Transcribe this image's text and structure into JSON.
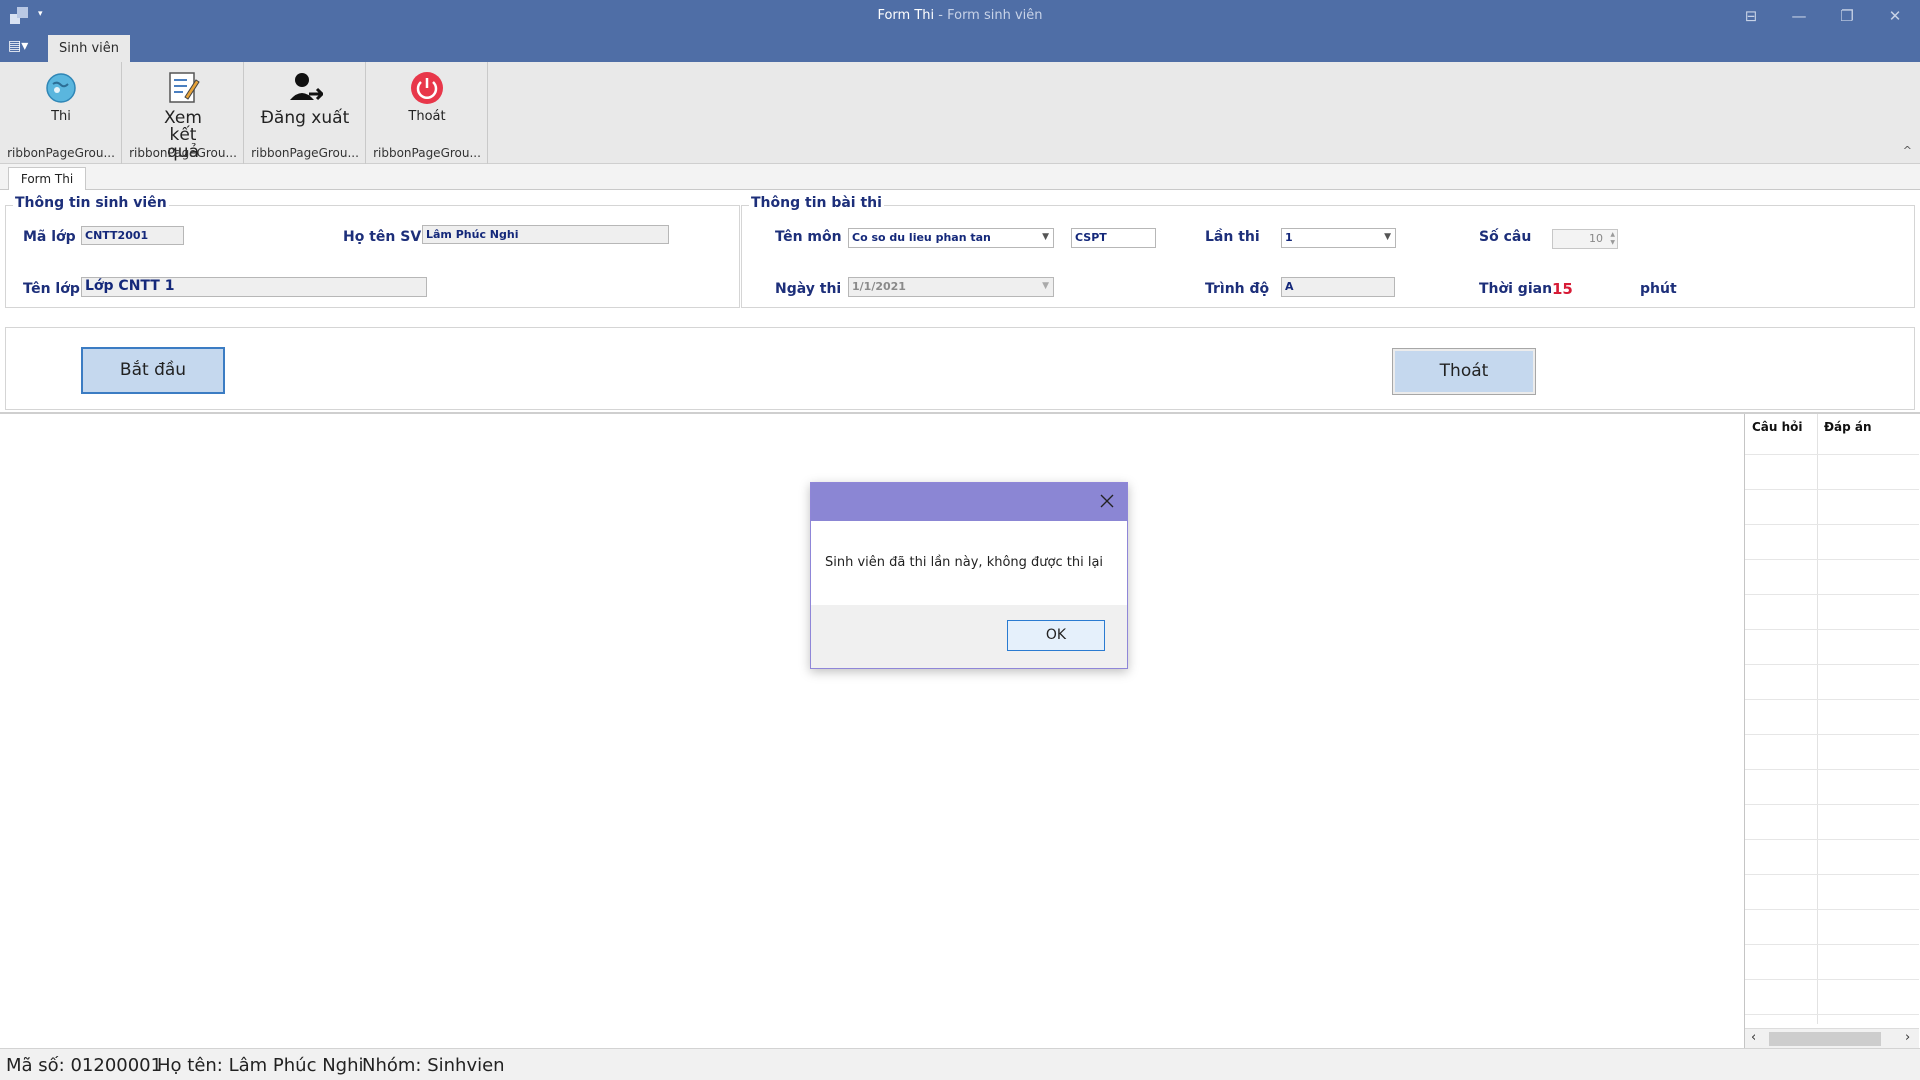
{
  "window": {
    "title_main": "Form Thi",
    "title_sub": " - Form sinh viên",
    "qat_arrow": "▾",
    "buttons": {
      "pin": "⊟",
      "minimize": "—",
      "restore": "❐",
      "close": "✕"
    }
  },
  "ribbon": {
    "app_menu": "▤▾",
    "tab": "Sinh viên",
    "groups": [
      {
        "label": "Thi",
        "icon": "globe-exam-icon",
        "caption": "ribbonPageGrou..."
      },
      {
        "label": "Xem kết quả",
        "icon": "edit-result-icon",
        "caption": "ribbonPageGrou..."
      },
      {
        "label": "Đăng xuất",
        "icon": "logout-user-icon",
        "caption": "ribbonPageGrou..."
      },
      {
        "label": "Thoát",
        "icon": "power-icon",
        "caption": "ribbonPageGrou..."
      }
    ],
    "collapse": "^"
  },
  "doc_tab": "Form Thi",
  "student_info": {
    "title": "Thông tin sinh viên",
    "ma_lop_label": "Mã lớp",
    "ma_lop": "CNTT2001",
    "ho_ten_label": "Họ tên SV",
    "ho_ten": "Lâm Phúc Nghi",
    "ten_lop_label": "Tên lớp",
    "ten_lop": "Lớp CNTT 1"
  },
  "exam_info": {
    "title": "Thông tin bài thi",
    "ten_mon_label": "Tên môn",
    "ten_mon": "Co so du lieu phan tan",
    "ma_mon": "CSPT",
    "lan_thi_label": "Lần thi",
    "lan_thi": "1",
    "so_cau_label": "Số câu",
    "so_cau": "10",
    "ngay_thi_label": "Ngày thi",
    "ngay_thi": "1/1/2021",
    "trinh_do_label": "Trình độ",
    "trinh_do": "A",
    "thoi_gian_label": "Thời gian",
    "thoi_gian": "15",
    "phut": "phút"
  },
  "actions": {
    "start": "Bắt đầu",
    "quit": "Thoát"
  },
  "grid": {
    "col1": "Câu hỏi",
    "col2": "Đáp án"
  },
  "status": {
    "ma_so": "Mã số: 01200001",
    "ho_ten": "Họ tên: Lâm Phúc Nghi",
    "nhom": "Nhóm: Sinhvien"
  },
  "dialog": {
    "message": "Sinh viên đã thi lần này, không được thi lại",
    "ok": "OK"
  },
  "colors": {
    "titlebar": "#4f6ea6",
    "label_blue": "#1d2f7a",
    "time_red": "#d71b36",
    "dialog_header": "#8b86d4",
    "button_fill": "#c5d8ee"
  }
}
